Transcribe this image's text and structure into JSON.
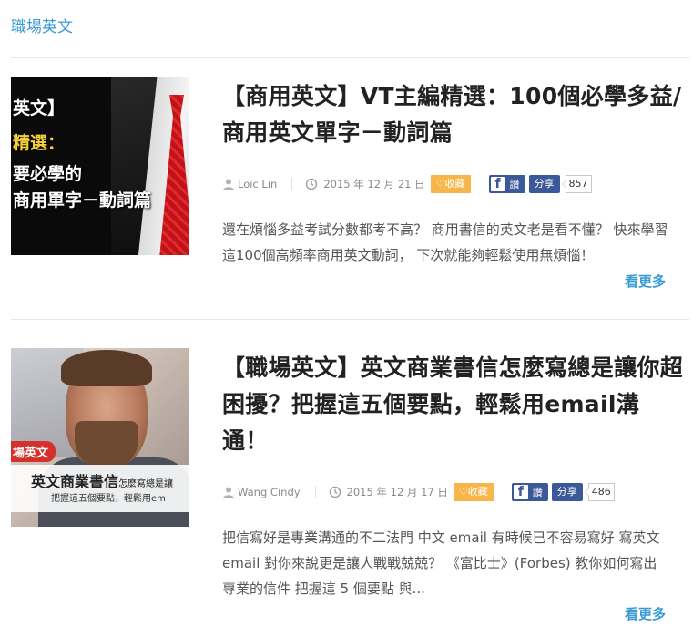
{
  "category": "職場英文",
  "posts": [
    {
      "thumb_lines": [
        "英文】",
        "精選：",
        "要必學的",
        "商用單字－動詞篇"
      ],
      "title": "【商用英文】VT主編精選：100個必學多益/商用英文單字－動詞篇",
      "author": "Loïc Lin",
      "date": "2015 年 12 月 21 日",
      "favorite_label": "♡收藏",
      "fb_label": "讚",
      "share_label": "分享",
      "share_count": "857",
      "excerpt": "還在煩惱多益考試分數都考不高？ 商用書信的英文老是看不懂？ 快來學習這100個高頻率商用英文動詞， 下次就能夠輕鬆使用無煩惱！",
      "more_label": "看更多"
    },
    {
      "thumb_tag": "場英文",
      "thumb_line1": "英文商業書信",
      "thumb_line1_small": "怎麼寫總是讓",
      "thumb_line2": "把握這五個要點，輕鬆用em",
      "title": "【職場英文】英文商業書信怎麼寫總是讓你超困擾？把握這五個要點，輕鬆用email溝通！",
      "author": "Wang Cindy",
      "date": "2015 年 12 月 17 日",
      "favorite_label": "♡收藏",
      "fb_label": "讚",
      "share_label": "分享",
      "share_count": "486",
      "excerpt": "把信寫好是專業溝通的不二法門 中文 email 有時候已不容易寫好 寫英文 email 對你來說更是讓人戰戰兢兢？ 《富比士》(Forbes) 教你如何寫出專業的信件 把握這 5 個要點 與...",
      "more_label": "看更多"
    }
  ],
  "colors": {
    "accent": "#3a9bd5",
    "favorite": "#f7b64a",
    "facebook": "#3b5998"
  }
}
